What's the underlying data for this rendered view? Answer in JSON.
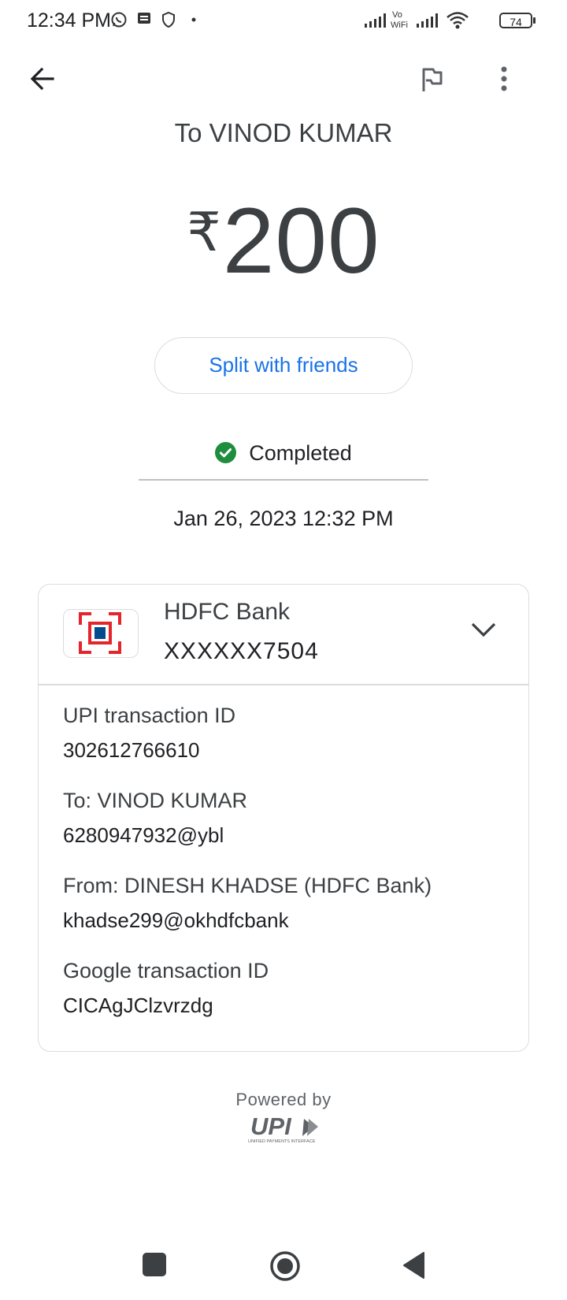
{
  "status_bar": {
    "time": "12:34 PM",
    "battery": "74",
    "icons": [
      "whatsapp-icon",
      "message-icon",
      "shield-icon",
      "dot-icon",
      "signal-icon",
      "vowifi-icon",
      "signal-icon",
      "wifi-icon",
      "battery-icon"
    ]
  },
  "header": {
    "back_icon": "arrow-left-icon",
    "flag_icon": "flag-icon",
    "more_icon": "more-vert-icon"
  },
  "payment": {
    "to_title": "To VINOD KUMAR",
    "currency": "₹",
    "amount": "200",
    "split_label": "Split with friends",
    "status": "Completed",
    "datetime": "Jan 26, 2023 12:32 PM"
  },
  "bank": {
    "name": "HDFC Bank",
    "account": "XXXXXX7504"
  },
  "details": [
    {
      "label": "UPI transaction ID",
      "value": "302612766610"
    },
    {
      "label": "To: VINOD KUMAR",
      "value": "6280947932@ybl"
    },
    {
      "label": "From: DINESH KHADSE (HDFC Bank)",
      "value": "khadse299@okhdfcbank"
    },
    {
      "label": "Google transaction ID",
      "value": "CICAgJClzvrzdg"
    }
  ],
  "footer": {
    "powered_by": "Powered by",
    "upi_logo_text": "UPI",
    "upi_tagline": "UNIFIED PAYMENTS INTERFACE"
  },
  "colors": {
    "accent": "#1a73e8",
    "success": "#1e8e3e",
    "hdfc_red": "#e4252b",
    "hdfc_blue": "#004c8f"
  }
}
